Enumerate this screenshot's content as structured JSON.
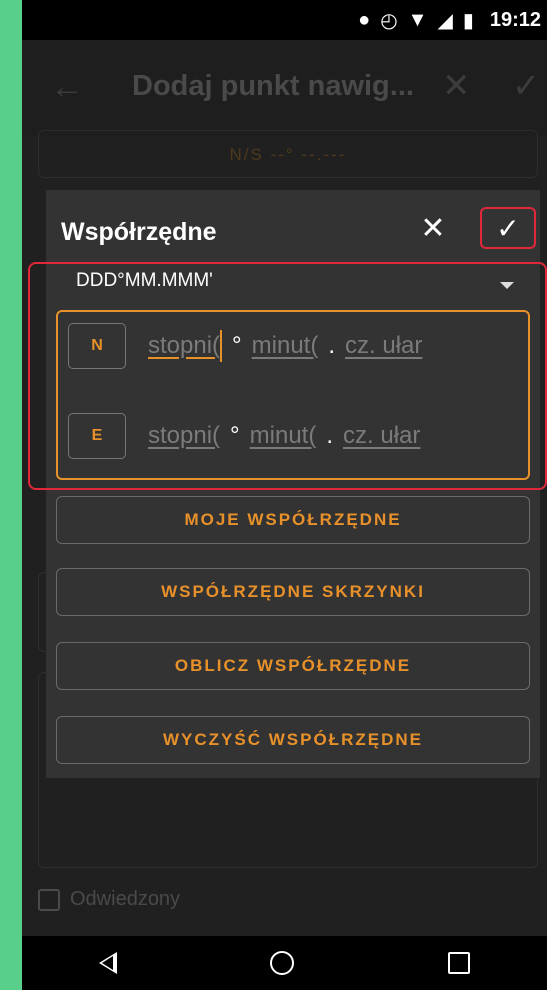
{
  "status_bar": {
    "time": "19:12"
  },
  "app_bar": {
    "title": "Dodaj punkt nawig...",
    "back_icon": "arrow-left-icon",
    "close_icon": "close-icon",
    "confirm_icon": "check-icon"
  },
  "form": {
    "ns_field": "N/S --° --.---",
    "visited_label": "Odwiedzony"
  },
  "dialog": {
    "title": "Współrzędne",
    "format": "DDD°MM.MMM'",
    "rows": [
      {
        "hemisphere": "N",
        "deg_placeholder": "stopni(",
        "deg_symbol": "°",
        "min_placeholder": "minut(",
        "dot": ".",
        "frac_placeholder": "cz. ułar"
      },
      {
        "hemisphere": "E",
        "deg_placeholder": "stopni(",
        "deg_symbol": "°",
        "min_placeholder": "minut(",
        "dot": ".",
        "frac_placeholder": "cz. ułar"
      }
    ],
    "buttons": {
      "my_coords": "MOJE WSPÓŁRZĘDNE",
      "cache_coords": "WSPÓŁRZĘDNE SKRZYNKI",
      "calc_coords": "OBLICZ WSPÓŁRZĘDNE",
      "clear_coords": "WYCZYŚĆ WSPÓŁRZĘDNE"
    }
  },
  "colors": {
    "accent": "#e8912a",
    "highlight": "#e0283a",
    "dialog_bg": "#333333",
    "background": "#58cf8a"
  }
}
